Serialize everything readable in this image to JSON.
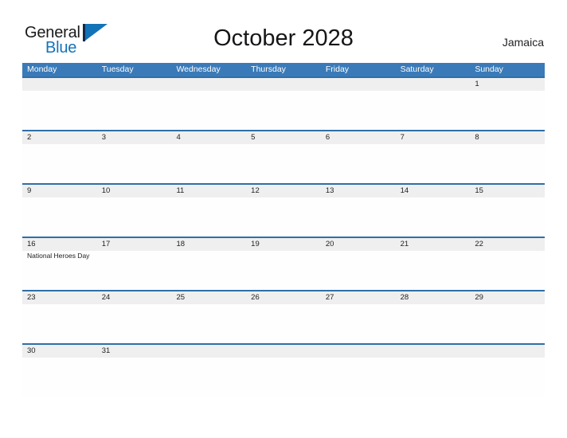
{
  "brand": {
    "name_part1": "General",
    "name_part2": "Blue",
    "flag_icon": "flag-icon",
    "accent_color": "#1273b9"
  },
  "header": {
    "title": "October 2028",
    "country": "Jamaica"
  },
  "colors": {
    "header_blue": "#3a7ab8",
    "row_line_blue": "#2f6fa8",
    "date_band_gray": "#efefef",
    "text_dark": "#222222",
    "white": "#ffffff"
  },
  "calendar": {
    "month": "October",
    "year": "2028",
    "weekday_headers": [
      "Monday",
      "Tuesday",
      "Wednesday",
      "Thursday",
      "Friday",
      "Saturday",
      "Sunday"
    ],
    "weeks": [
      {
        "days": [
          {
            "number": "",
            "event": ""
          },
          {
            "number": "",
            "event": ""
          },
          {
            "number": "",
            "event": ""
          },
          {
            "number": "",
            "event": ""
          },
          {
            "number": "",
            "event": ""
          },
          {
            "number": "",
            "event": ""
          },
          {
            "number": "1",
            "event": ""
          }
        ]
      },
      {
        "days": [
          {
            "number": "2",
            "event": ""
          },
          {
            "number": "3",
            "event": ""
          },
          {
            "number": "4",
            "event": ""
          },
          {
            "number": "5",
            "event": ""
          },
          {
            "number": "6",
            "event": ""
          },
          {
            "number": "7",
            "event": ""
          },
          {
            "number": "8",
            "event": ""
          }
        ]
      },
      {
        "days": [
          {
            "number": "9",
            "event": ""
          },
          {
            "number": "10",
            "event": ""
          },
          {
            "number": "11",
            "event": ""
          },
          {
            "number": "12",
            "event": ""
          },
          {
            "number": "13",
            "event": ""
          },
          {
            "number": "14",
            "event": ""
          },
          {
            "number": "15",
            "event": ""
          }
        ]
      },
      {
        "days": [
          {
            "number": "16",
            "event": "National Heroes Day"
          },
          {
            "number": "17",
            "event": ""
          },
          {
            "number": "18",
            "event": ""
          },
          {
            "number": "19",
            "event": ""
          },
          {
            "number": "20",
            "event": ""
          },
          {
            "number": "21",
            "event": ""
          },
          {
            "number": "22",
            "event": ""
          }
        ]
      },
      {
        "days": [
          {
            "number": "23",
            "event": ""
          },
          {
            "number": "24",
            "event": ""
          },
          {
            "number": "25",
            "event": ""
          },
          {
            "number": "26",
            "event": ""
          },
          {
            "number": "27",
            "event": ""
          },
          {
            "number": "28",
            "event": ""
          },
          {
            "number": "29",
            "event": ""
          }
        ]
      },
      {
        "days": [
          {
            "number": "30",
            "event": ""
          },
          {
            "number": "31",
            "event": ""
          },
          {
            "number": "",
            "event": ""
          },
          {
            "number": "",
            "event": ""
          },
          {
            "number": "",
            "event": ""
          },
          {
            "number": "",
            "event": ""
          },
          {
            "number": "",
            "event": ""
          }
        ]
      }
    ]
  }
}
